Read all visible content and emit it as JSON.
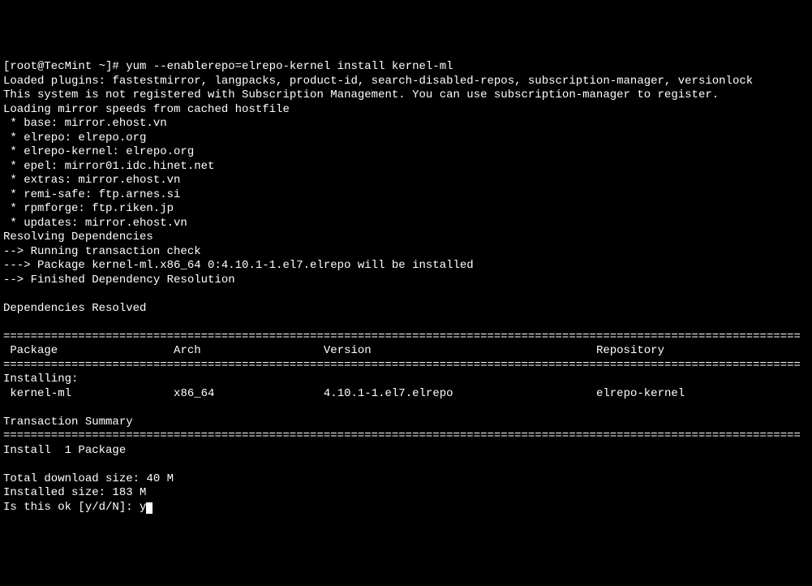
{
  "prompt": {
    "user_host": "[root@TecMint ~]#",
    "command": "yum --enablerepo=elrepo-kernel install kernel-ml"
  },
  "output": {
    "plugins_line": "Loaded plugins: fastestmirror, langpacks, product-id, search-disabled-repos, subscription-manager, versionlock",
    "subscription_line": "This system is not registered with Subscription Management. You can use subscription-manager to register.",
    "loading_line": "Loading mirror speeds from cached hostfile",
    "mirrors": [
      " * base: mirror.ehost.vn",
      " * elrepo: elrepo.org",
      " * elrepo-kernel: elrepo.org",
      " * epel: mirror01.idc.hinet.net",
      " * extras: mirror.ehost.vn",
      " * remi-safe: ftp.arnes.si",
      " * rpmforge: ftp.riken.jp",
      " * updates: mirror.ehost.vn"
    ],
    "resolving": "Resolving Dependencies",
    "trans_check": "--> Running transaction check",
    "package_line": "---> Package kernel-ml.x86_64 0:4.10.1-1.el7.elrepo will be installed",
    "finished": "--> Finished Dependency Resolution",
    "deps_resolved": "Dependencies Resolved",
    "separator": "=====================================================================================================================",
    "headers": {
      "package": " Package",
      "arch": "Arch",
      "version": "Version",
      "repository": "Repository"
    },
    "installing_label": "Installing:",
    "row": {
      "package": " kernel-ml",
      "arch": "x86_64",
      "version": "4.10.1-1.el7.elrepo",
      "repository": "elrepo-kernel"
    },
    "trans_summary": "Transaction Summary",
    "install_count": "Install  1 Package",
    "download_size": "Total download size: 40 M",
    "installed_size": "Installed size: 183 M",
    "confirm_prompt": "Is this ok [y/d/N]: ",
    "confirm_input": "y"
  }
}
